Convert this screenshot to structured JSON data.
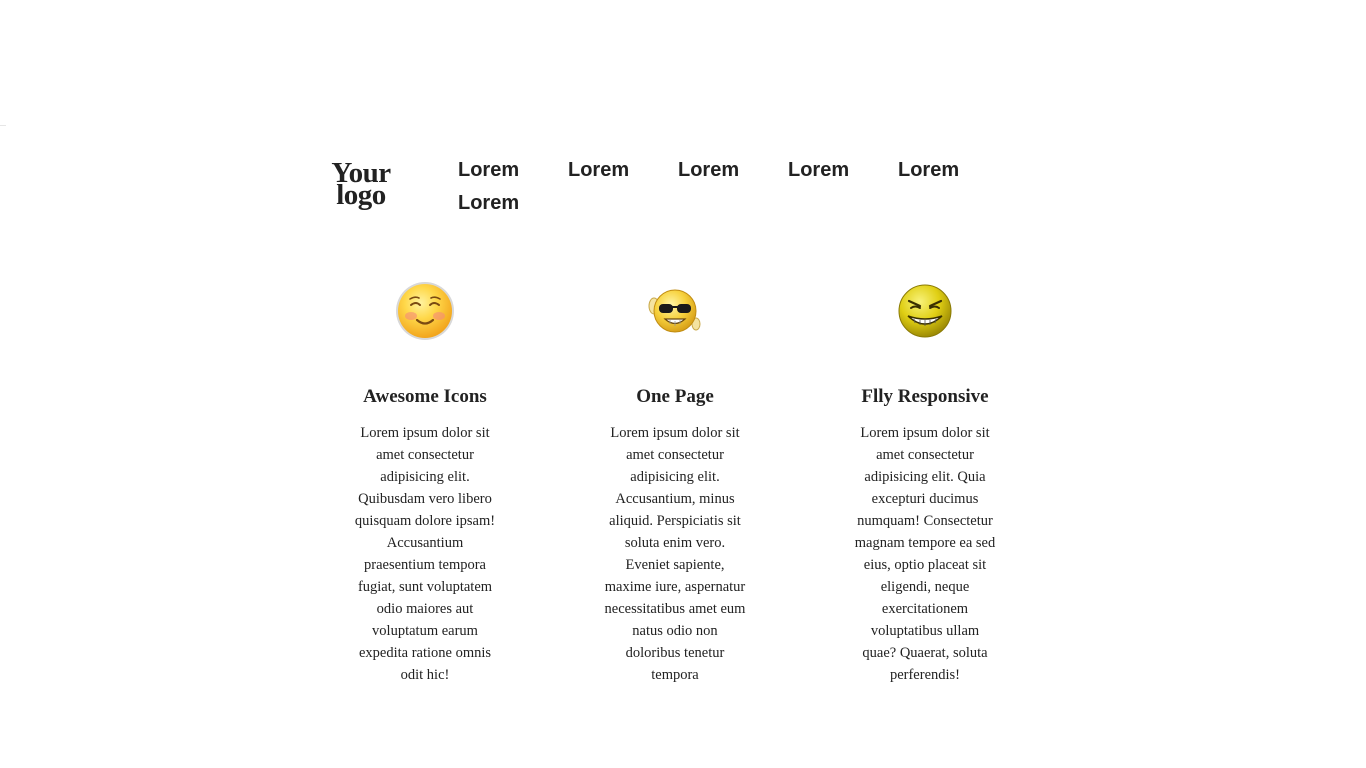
{
  "logo": {
    "line1": "Your",
    "line2": "logo"
  },
  "nav": {
    "items": [
      {
        "label": "Lorem"
      },
      {
        "label": "Lorem"
      },
      {
        "label": "Lorem"
      },
      {
        "label": "Lorem"
      },
      {
        "label": "Lorem"
      },
      {
        "label": "Lorem"
      }
    ]
  },
  "features": [
    {
      "icon": "smiling-face-icon",
      "title": "Awesome Icons",
      "text": "Lorem ipsum dolor sit amet consectetur adipisicing elit. Quibusdam vero libero quisquam dolore ipsam! Accusantium praesentium tempora fugiat, sunt voluptatem odio maiores aut voluptatum earum expedita ratione omnis odit hic!"
    },
    {
      "icon": "cool-sunglasses-face-icon",
      "title": "One Page",
      "text": "Lorem ipsum dolor sit amet consectetur adipisicing elit. Accusantium, minus aliquid. Perspiciatis sit soluta enim vero. Eveniet sapiente, maxime iure, aspernatur necessitatibus amet eum natus odio non doloribus tenetur tempora"
    },
    {
      "icon": "grinning-face-icon",
      "title": "Flly Responsive",
      "text": "Lorem ipsum dolor sit amet consectetur adipisicing elit. Quia excepturi ducimus numquam! Consectetur magnam tempore ea sed eius, optio placeat sit eligendi, neque exercitationem voluptatibus ullam quae? Quaerat, soluta perferendis!"
    }
  ]
}
